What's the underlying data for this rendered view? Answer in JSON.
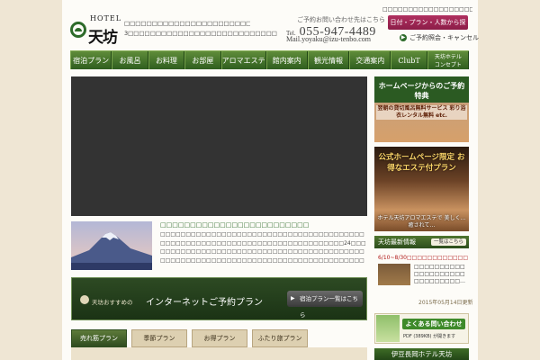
{
  "header": {
    "logo_hotel": "HOTEL",
    "logo_name": "天坊",
    "tagline_1": "□□□□□□□□□□□□□□□□□□□□□□□□ □□□□□□",
    "tagline_2": "3□□□□□□□□□□□□□□□□□□□□□□□□□□□□□□□□□□□□□□",
    "contact_label": "ご予約お問い合わせ先はこちら",
    "tel_label": "Tel.",
    "tel_number": "055-947-4489",
    "mail": "Mail.yoyaku@izu-tenbo.com",
    "top_right_text": "□□□□□□□□□□□□□□□□□□□□□□ □□□□□□",
    "search_button": "日付・プラン・人数から探す",
    "cancel_link": "ご予約照会・キャンセル"
  },
  "nav": {
    "items": [
      "宿泊プラン",
      "お風呂",
      "お料理",
      "お部屋",
      "アロマエステ",
      "館内案内",
      "観光情報",
      "交通案内",
      "ClubT"
    ],
    "last_line1": "天坊ホテル",
    "last_line2": "コンセプト"
  },
  "news_main": {
    "title": "□□□□□□□□□□□□□□□□□□□□□□□□□",
    "body": "□□□□□□□□□□□□□□□□□□□□□□□□□□□□□□□□□□□□□□□□□□□□□□□□□□□□□□□□□□□□□□□□□□□□□□□□□□□□24□□□□□□□□□□□□□□□□□□□□□□□□□□□□□□□□□□□□□□□□□□□□□□□□□□□□□□□□□□□□□□□□□□□□□□□□□□□□□□□□□□□□□□□□□□□□□□□□□□□□□□□□□□□□□□□□□□□□□□□□□□□□□□□□□□□□□□□□□□□□□□□□□□□□□□□□"
  },
  "plan_banner": {
    "small": "天坊おすすめの",
    "big": "インターネットご予約プラン",
    "button": "宿泊プラン一覧はこちら"
  },
  "tabs": [
    "売れ筋プラン",
    "季節プラン",
    "お得プラン",
    "ふたり旅プラン"
  ],
  "sidebar": {
    "banner1_title": "ホームページからのご予約特典",
    "banner1_body": "翌朝の貸切風呂無料サービス 彩り浴衣レンタル無料 etc.",
    "banner2_title": "公式ホームページ限定 お得なエステ付プラン",
    "banner2_body": "ホテル天坊アロマエステで 美しく…癒されて…",
    "news_head": "天坊最新情報",
    "news_more": "一覧はこちら",
    "news_date_line": "6/10~8/30□□□□□□□□□□□□□□□□□",
    "news_text": "□□□□□□□□□□□□□□□□□□□□□□□□□□□□□…",
    "news_date": "2015年05月14日更新",
    "faq_title": "よくある問い合わせ",
    "faq_sub": "PDF (389KB) が開きます",
    "footer_title": "伊豆長岡ホテル天坊"
  }
}
